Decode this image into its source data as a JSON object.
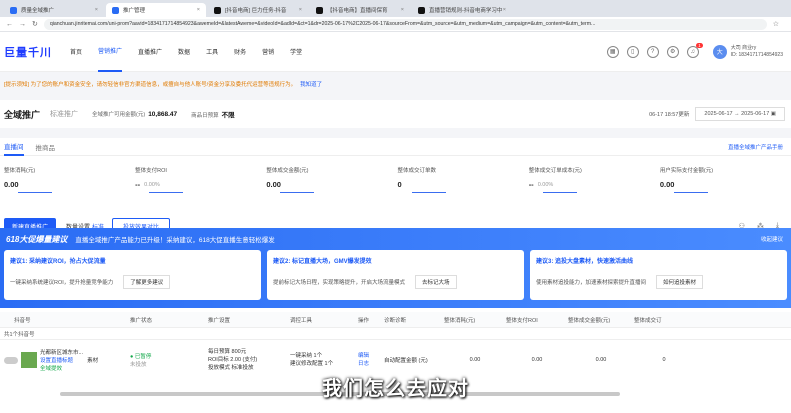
{
  "browser": {
    "tabs": [
      {
        "label": "质量全域推广",
        "color": "#2a6cf4",
        "active": false
      },
      {
        "label": "推广管理",
        "color": "#2a6cf4",
        "active": true
      },
      {
        "label": "[抖音电商] 巨力任务-抖音",
        "color": "#111111",
        "active": false
      },
      {
        "label": "【抖音电商】直播间保育",
        "color": "#111111",
        "active": false
      },
      {
        "label": "直播营销规则-抖音电商学习中",
        "color": "#111111",
        "active": false
      }
    ],
    "url": "qianchuan.jinritemai.com/uni-prom?aavid=1834171714854923&awemeId=&latestAweme=&videoId=&adId=&ct=1&dr=2025-06-17%2C2025-06-17&sourceFrom=&utm_source=&utm_medium=&utm_campaign=&utm_content=&utm_term..."
  },
  "topnav": {
    "logo": "巨量千川",
    "items": [
      "首页",
      "营销推广",
      "直播推广",
      "数据",
      "工具",
      "财务",
      "营销",
      "学堂"
    ],
    "active_index": 1,
    "badge_count": "1",
    "user_name": "大司 商业ry",
    "user_id": "ID: 1834171714854923"
  },
  "notice": {
    "text": "[提示须知] 为了您的账户和资金安全，请勿轻信非官方渠道信息，或擅自与他人账号/资金分享及委托代运营等违规行为。",
    "link": "我知道了"
  },
  "titlebar": {
    "title": "全域推广",
    "subtitle": "标准推广",
    "stat1_label": "全域推广可用金额(元)",
    "stat1_value": "10,868.47",
    "stat2_label": "商品日预算",
    "stat2_value": "不限",
    "date_label": "06-17 18:57更新",
    "date_start": "2025-06-17",
    "date_sep": "→",
    "date_end": "2025-06-17"
  },
  "main": {
    "tabs": [
      "直播间",
      "推商品"
    ],
    "help_link": "直播全域推广产品手册",
    "metrics": [
      {
        "label": "整体消耗(元)",
        "value": "0.00",
        "delta": ""
      },
      {
        "label": "整体支付ROI",
        "value": "--",
        "delta": "0.00%"
      },
      {
        "label": "整体成交金额(元)",
        "value": "0.00",
        "delta": ""
      },
      {
        "label": "整体成交订单数",
        "value": "0",
        "delta": ""
      },
      {
        "label": "整体成交订单成本(元)",
        "value": "--",
        "delta": "0.00%"
      },
      {
        "label": "用户实际支付金额(元)",
        "value": "0.00",
        "delta": ""
      }
    ],
    "create_btn": "新建直播推广",
    "sort_label": "数量设置",
    "sort_link": "标准",
    "outline_btn": "投放效果对比"
  },
  "promo": {
    "title": "618大促爆量建议",
    "subtitle": "直播全域推广产品能力已升级！采纳建议，618大促直播生意轻松爆发",
    "close": "收起建议",
    "suggestions": [
      {
        "num": "建议1:",
        "title": "采纳建议ROI，抢占大促流量",
        "body": "一键采纳系统建议ROI，提升抢量竞争能力",
        "link": "了解更多建议"
      },
      {
        "num": "建议2:",
        "title": "标记直播大场，GMV爆发提效",
        "body": "提前标记大场日程，实现策略提升，开启大场流量模式",
        "link": "去标记大场"
      },
      {
        "num": "建议3:",
        "title": "追投大盘素材，快速激活曲线",
        "body": "使用素材追投能力，加速素材探索提升直播间",
        "link": "如何追投素材"
      }
    ]
  },
  "table": {
    "headers": [
      "抖音号",
      "推广状态",
      "推广设置",
      "调控工具",
      "操作",
      "诊断诊断",
      "整体消耗(元)",
      "整体支付ROI",
      "整体成交金额(元)",
      "整体成交订"
    ],
    "summary": "共1个抖音号",
    "row": {
      "account": "光都新区城东市...",
      "account_sub": "设置直播标题",
      "product": "素材",
      "status": "已暂停",
      "status_sub": "未投放",
      "budget": "每日预算 800元",
      "roi": "ROI目标 2.00 (支付)",
      "mode": "投放模式 标准投放",
      "tool": "一键采纳 1个",
      "tool2": "建议修改配置 1个",
      "op1": "编辑",
      "op2": "日志",
      "cost": "0.00",
      "roi_val": "0.00",
      "gmv": "0.00",
      "orders": "0",
      "tag": "全域提效",
      "extra": "自动配置金额 (元)"
    }
  },
  "caption": "我们怎么去应对"
}
